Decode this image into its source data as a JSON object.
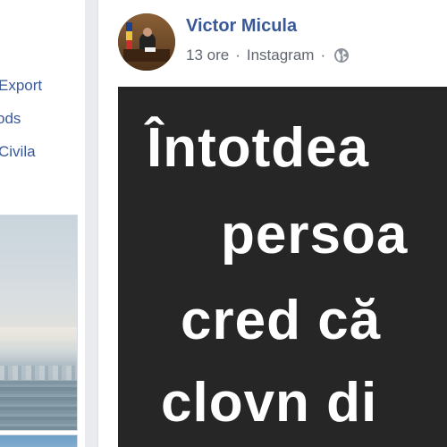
{
  "sidebar": {
    "links": [
      {
        "label": "Export"
      },
      {
        "label": "ods"
      },
      {
        "label": "Civila"
      }
    ]
  },
  "post": {
    "author": "Victor Micula",
    "time": "13 ore",
    "separator": "·",
    "source": "Instagram",
    "privacy_icon": "globe-icon",
    "image_text": {
      "lines": [
        "Întotdea",
        "persoa",
        "cred că",
        "clovn di"
      ]
    }
  },
  "colors": {
    "link": "#385898",
    "meta": "#606770",
    "image_bg": "#262626",
    "page_bg": "#e9ebee"
  }
}
